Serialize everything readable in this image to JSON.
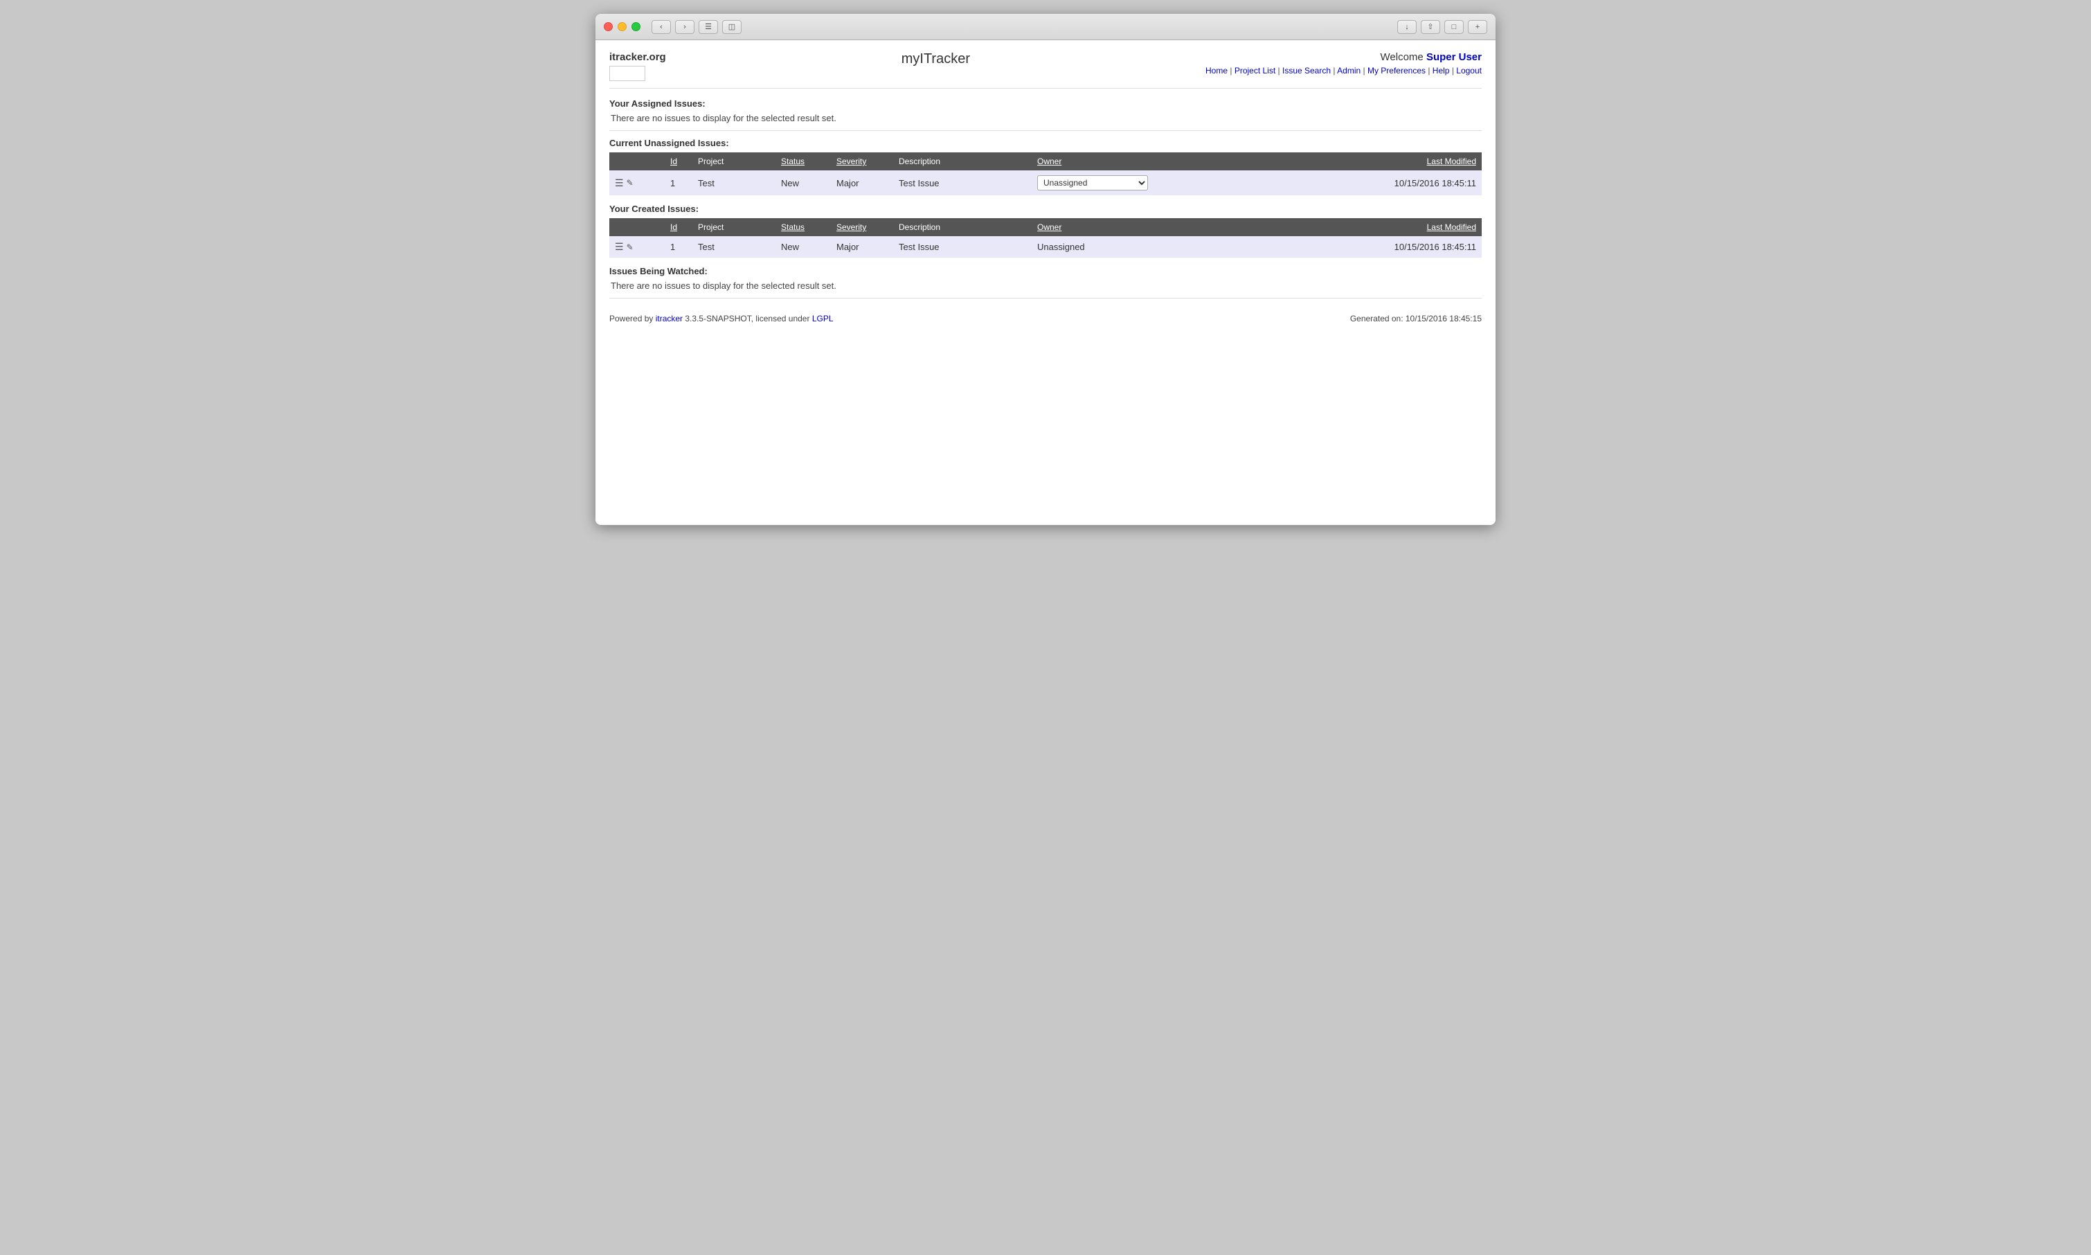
{
  "window": {
    "titlebar": {
      "buttons": [
        "back",
        "forward",
        "reader",
        "share"
      ]
    }
  },
  "header": {
    "logo_text": "itracker.org",
    "site_title": "myITracker",
    "welcome_label": "Welcome",
    "username": "Super User",
    "nav": {
      "home": "Home",
      "project_list": "Project List",
      "issue_search": "Issue Search",
      "admin": "Admin",
      "my_preferences": "My Preferences",
      "help": "Help",
      "logout": "Logout"
    }
  },
  "assigned_issues": {
    "section_title": "Your Assigned Issues:",
    "empty_message": "There are no issues to display for the selected result set."
  },
  "unassigned_issues": {
    "section_title": "Current Unassigned Issues:",
    "columns": {
      "id": "Id",
      "project": "Project",
      "status": "Status",
      "severity": "Severity",
      "description": "Description",
      "owner": "Owner",
      "last_modified": "Last Modified"
    },
    "rows": [
      {
        "id": "1",
        "project": "Test",
        "status": "New",
        "severity": "Major",
        "description": "Test Issue",
        "owner": "Unassigned",
        "last_modified": "10/15/2016 18:45:11"
      }
    ]
  },
  "created_issues": {
    "section_title": "Your Created Issues:",
    "columns": {
      "id": "Id",
      "project": "Project",
      "status": "Status",
      "severity": "Severity",
      "description": "Description",
      "owner": "Owner",
      "last_modified": "Last Modified"
    },
    "rows": [
      {
        "id": "1",
        "project": "Test",
        "status": "New",
        "severity": "Major",
        "description": "Test Issue",
        "owner": "Unassigned",
        "last_modified": "10/15/2016 18:45:11"
      }
    ]
  },
  "watched_issues": {
    "section_title": "Issues Being Watched:",
    "empty_message": "There are no issues to display for the selected result set."
  },
  "footer": {
    "powered_by": "Powered by ",
    "itracker_link": "itracker",
    "version_text": " 3.3.5-SNAPSHOT, licensed under ",
    "lgpl_link": "LGPL",
    "generated_label": "Generated on: 10/15/2016 18:45:15"
  }
}
